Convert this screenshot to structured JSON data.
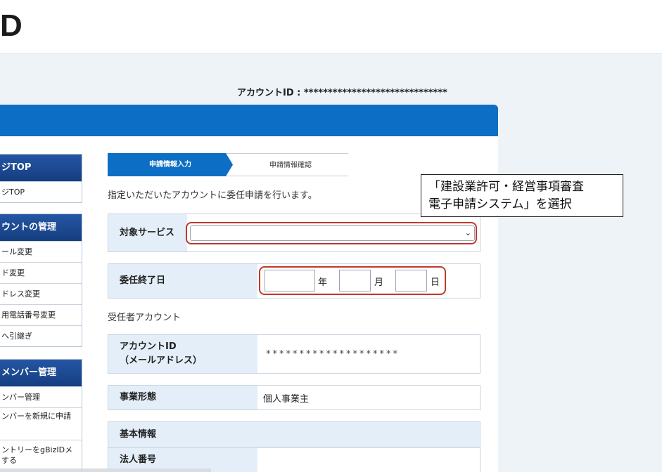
{
  "header": {
    "logo_text": "D"
  },
  "account": {
    "id_label": "アカウントID : ******************************"
  },
  "sidebar": {
    "sections": [
      {
        "title": "ジTOP",
        "items": [
          "ジTOP"
        ]
      },
      {
        "title": "ウントの管理",
        "items": [
          "ール変更",
          "ド変更",
          "ドレス変更",
          "用電話番号変更",
          "へ引継ぎ"
        ]
      },
      {
        "title": "メンバー管理",
        "items": [
          "ンバー管理",
          "ンバーを新規に申請",
          "ントリーをgBizIDメ\nする"
        ]
      }
    ]
  },
  "steps": {
    "step1": "申請情報入力",
    "step2": "申請情報確認"
  },
  "intro_text": "指定いただいたアカウントに委任申請を行います。",
  "form": {
    "service_label": "対象サービス",
    "service_value": "",
    "end_date_label": "委任終了日",
    "year_unit": "年",
    "month_unit": "月",
    "day_unit": "日"
  },
  "delegate": {
    "heading": "受任者アカウント",
    "account_label_line1": "アカウントID",
    "account_label_line2": "（メールアドレス）",
    "account_value": "********************",
    "business_label": "事業形態",
    "business_value": "個人事業主",
    "basic_info_label": "基本情報",
    "corp_number_label": "法人番号"
  },
  "callout": {
    "line1": "「建設業許可・経営事項審査",
    "line2": "電子申請システム」を選択"
  },
  "colors": {
    "primary": "#0c6ec4",
    "sidebar_head": "#1c4a93",
    "highlight": "#c0392b"
  }
}
